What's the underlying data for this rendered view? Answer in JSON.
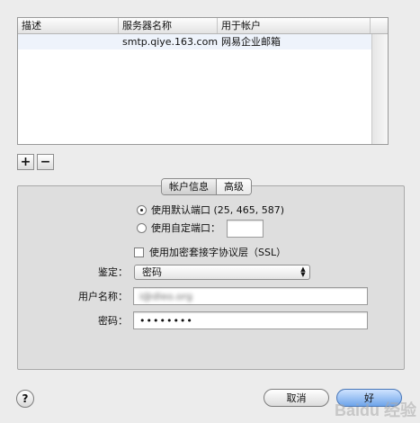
{
  "table": {
    "headers": [
      "描述",
      "服务器名称",
      "用于帐户"
    ],
    "rows": [
      {
        "description": "",
        "server": "smtp.qiye.163.com",
        "account": "网易企业邮箱"
      }
    ]
  },
  "toolbar": {
    "add_label": "+",
    "remove_label": "−"
  },
  "tabs": {
    "account_info": "帐户信息",
    "advanced": "高级"
  },
  "port": {
    "default_label": "使用默认端口 (25, 465, 587)",
    "custom_label": "使用自定端口：",
    "custom_value": "",
    "selected": "default"
  },
  "ssl": {
    "label": "使用加密套接字协议层（SSL）",
    "checked": false
  },
  "auth": {
    "label": "鉴定：",
    "value": "密码"
  },
  "username": {
    "label": "用户名称：",
    "value": "i@dleo.org"
  },
  "password": {
    "label": "密码：",
    "value": "••••••••"
  },
  "buttons": {
    "cancel": "取消",
    "ok": "好",
    "help": "?"
  },
  "watermark": "Baidu 经验",
  "colors": {
    "ok_button": "#6ea4ea",
    "panel": "#dedede",
    "window": "#ececec"
  }
}
